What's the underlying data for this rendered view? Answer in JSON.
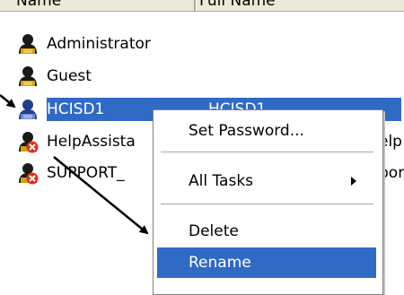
{
  "columns": {
    "name": "Name",
    "full_name": "Full Name"
  },
  "users": [
    {
      "name": "Administrator",
      "full_name": "",
      "icon": "user-icon",
      "disabled": false
    },
    {
      "name": "Guest",
      "full_name": "",
      "icon": "user-icon",
      "disabled": false
    },
    {
      "name": "HCISD1",
      "full_name": "HCISD1",
      "icon": "user-icon",
      "disabled": false,
      "selected": true
    },
    {
      "name": "HelpAssista",
      "full_name": "elp",
      "icon": "disabled-user-icon",
      "disabled": true
    },
    {
      "name": "SUPPORT_",
      "full_name": "por",
      "icon": "disabled-user-icon",
      "disabled": true
    }
  ],
  "context_menu": {
    "items": [
      {
        "label": "Set Password...",
        "has_submenu": false,
        "highlighted": false
      },
      {
        "label": "All Tasks",
        "has_submenu": true,
        "highlighted": false
      },
      {
        "label": "Delete",
        "has_submenu": false,
        "highlighted": false
      },
      {
        "label": "Rename",
        "has_submenu": false,
        "highlighted": true
      }
    ]
  },
  "colors": {
    "selection": "#316ac5",
    "header_bg": "#ece9d8",
    "menu_border": "#808080",
    "arrow": "#000000"
  }
}
